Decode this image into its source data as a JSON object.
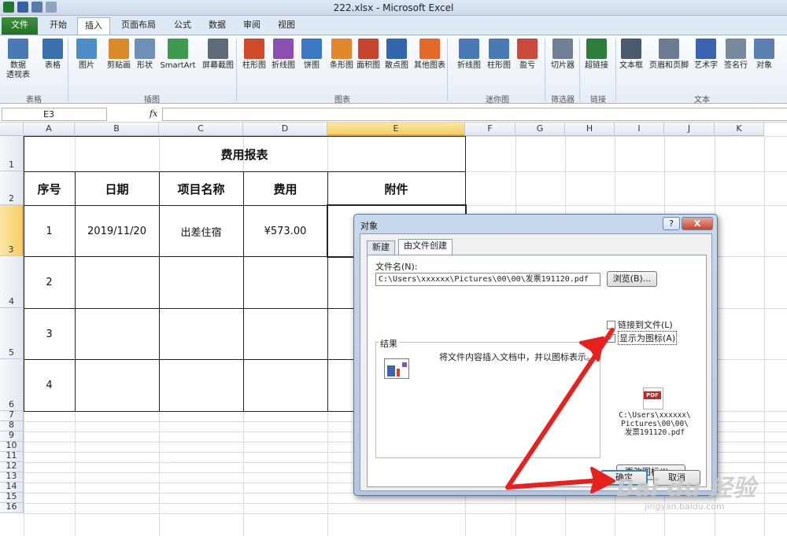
{
  "window": {
    "title": "222.xlsx - Microsoft Excel"
  },
  "tabs": [
    "文件",
    "开始",
    "插入",
    "页面布局",
    "公式",
    "数据",
    "审阅",
    "视图"
  ],
  "ribbon": {
    "buttons": [
      {
        "label": "数据\n透视表",
        "icon": "pivot-table-icon",
        "color": "#4a7ab5"
      },
      {
        "label": "表格",
        "icon": "table-icon",
        "color": "#3a6fb0"
      },
      {
        "label": "图片",
        "icon": "picture-icon",
        "color": "#4f8ec4"
      },
      {
        "label": "剪贴画",
        "icon": "clipart-icon",
        "color": "#d98b2c"
      },
      {
        "label": "形状",
        "icon": "shapes-icon",
        "color": "#6d8fb8"
      },
      {
        "label": "SmartArt",
        "icon": "smartart-icon",
        "color": "#3d9a4e"
      },
      {
        "label": "屏幕截图",
        "icon": "screenshot-icon",
        "color": "#5f6a78"
      },
      {
        "label": "柱形图",
        "icon": "column-chart-icon",
        "color": "#d04a2a"
      },
      {
        "label": "折线图",
        "icon": "line-chart-icon",
        "color": "#8a4fb0"
      },
      {
        "label": "饼图",
        "icon": "pie-chart-icon",
        "color": "#3a78c4"
      },
      {
        "label": "条形图",
        "icon": "bar-chart-icon",
        "color": "#e2872a"
      },
      {
        "label": "面积图",
        "icon": "area-chart-icon",
        "color": "#c9442e"
      },
      {
        "label": "散点图",
        "icon": "scatter-chart-icon",
        "color": "#3466b0"
      },
      {
        "label": "其他图表",
        "icon": "other-chart-icon",
        "color": "#e36a2a"
      },
      {
        "label": "折线图",
        "icon": "sparkline-line-icon",
        "color": "#4a7ab5"
      },
      {
        "label": "柱形图",
        "icon": "sparkline-column-icon",
        "color": "#4a7ab5"
      },
      {
        "label": "盈亏",
        "icon": "sparkline-winloss-icon",
        "color": "#c94a3a"
      },
      {
        "label": "切片器",
        "icon": "slicer-icon",
        "color": "#6f7f95"
      },
      {
        "label": "超链接",
        "icon": "hyperlink-icon",
        "color": "#2f7d3a"
      },
      {
        "label": "文本框",
        "icon": "textbox-icon",
        "color": "#4a5a6e"
      },
      {
        "label": "页眉和页脚",
        "icon": "header-footer-icon",
        "color": "#6b7c92"
      },
      {
        "label": "艺术字",
        "icon": "wordart-icon",
        "color": "#3a63b0"
      },
      {
        "label": "签名行",
        "icon": "signature-icon",
        "color": "#7a8a9e"
      },
      {
        "label": "对象",
        "icon": "object-icon",
        "color": "#5a7fb0"
      }
    ],
    "groups": [
      "表格",
      "插图",
      "图表",
      "迷你图",
      "筛选器",
      "链接",
      "文本"
    ]
  },
  "formula_bar": {
    "cell_ref": "E3",
    "fx": "fx",
    "value": ""
  },
  "columns": [
    "A",
    "B",
    "C",
    "D",
    "E",
    "F",
    "G",
    "H",
    "I",
    "J",
    "K"
  ],
  "rows": [
    "1",
    "2",
    "3",
    "4",
    "5",
    "6",
    "7",
    "8",
    "9",
    "10",
    "11",
    "12",
    "13",
    "14",
    "15",
    "16"
  ],
  "sheet": {
    "title": "费用报表",
    "headers": [
      "序号",
      "日期",
      "项目名称",
      "费用",
      "附件"
    ],
    "rows": [
      [
        "1",
        "2019/11/20",
        "出差住宿",
        "¥573.00",
        ""
      ],
      [
        "2",
        "",
        "",
        "",
        ""
      ],
      [
        "3",
        "",
        "",
        "",
        ""
      ],
      [
        "4",
        "",
        "",
        "",
        ""
      ]
    ]
  },
  "dialog": {
    "title": "对象",
    "help": "?",
    "close": "X",
    "tabs": [
      "新建",
      "由文件创建"
    ],
    "filename_label": "文件名(N):",
    "filename_value": "C:\\Users\\xxxxxx\\Pictures\\00\\00\\发票191120.pdf",
    "browse_button": "浏览(B)...",
    "link_checkbox": {
      "label": "链接到文件(L)",
      "checked": false
    },
    "icon_checkbox": {
      "label": "显示为图标(A)",
      "checked": true
    },
    "result_label": "结果",
    "result_text": "将文件内容插入文档中，并以图标表示。",
    "icon_caption": [
      "C:\\Users\\xxxxxx\\",
      "Pictures\\00\\00\\",
      "发票191120.pdf"
    ],
    "change_icon_button": "更改图标(I)...",
    "ok_button": "确定",
    "cancel_button": "取消"
  },
  "watermark": {
    "brand": "Bai du 经验",
    "url": "jingyan.baidu.com"
  }
}
